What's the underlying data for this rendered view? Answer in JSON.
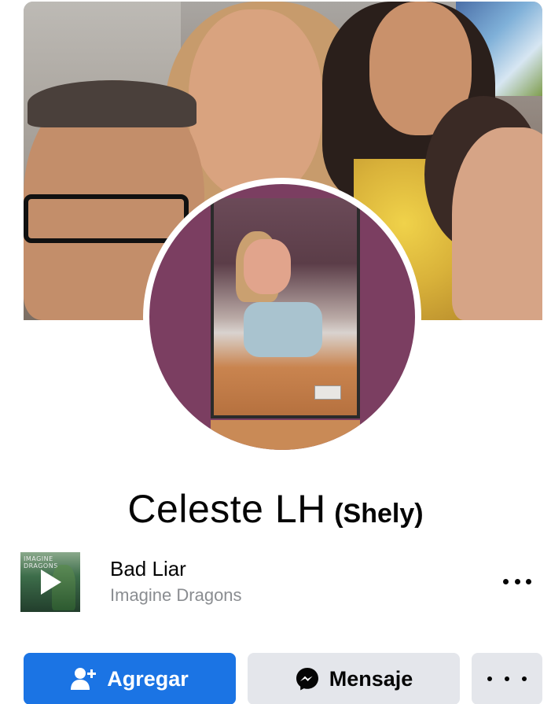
{
  "profile": {
    "name": "Celeste LH",
    "alternate_name": "(Shely)"
  },
  "music": {
    "album_art_text": "IMAGINE DRAGONS",
    "song_title": "Bad Liar",
    "artist": "Imagine Dragons"
  },
  "actions": {
    "add_friend_label": "Agregar",
    "message_label": "Mensaje"
  },
  "colors": {
    "primary_button": "#1b74e4",
    "secondary_button": "#e4e6eb",
    "secondary_text": "#8a8d91"
  },
  "icons": {
    "add_friend": "add-user-icon",
    "message": "messenger-icon",
    "more": "more-dots-icon",
    "play": "play-icon"
  }
}
